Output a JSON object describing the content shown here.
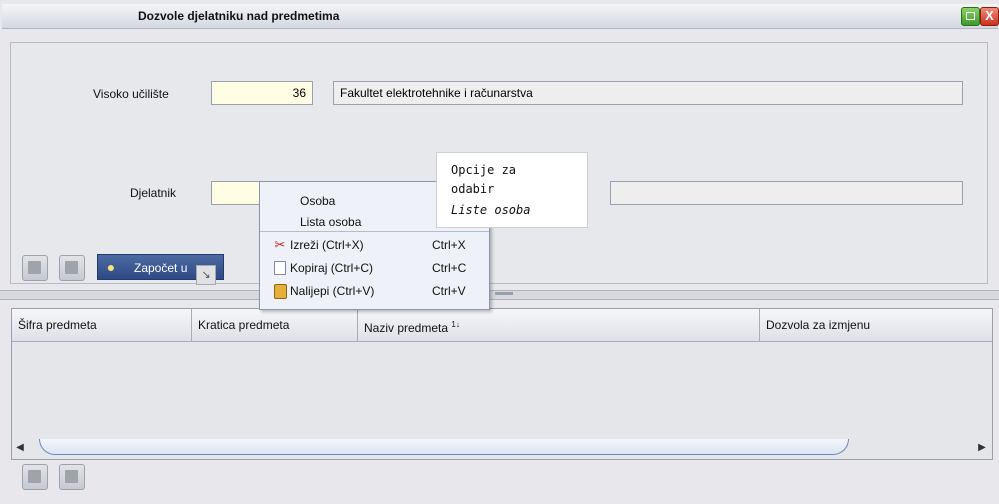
{
  "window": {
    "title": "Dozvole djelatniku nad predmetima",
    "close_label": "X"
  },
  "form": {
    "institution": {
      "label": "Visoko učilište",
      "code": "36",
      "name": "Fakultet elektrotehnike i računarstva"
    },
    "employee": {
      "label": "Djelatnik",
      "code": "",
      "name": ""
    }
  },
  "toolbar": {
    "start_label": "Započet u"
  },
  "context_menu": {
    "items": [
      {
        "label": "Osoba"
      },
      {
        "label": "Lista osoba"
      },
      {
        "label": "Izreži (Ctrl+X)",
        "shortcut": "Ctrl+X",
        "icon": "scissors-icon"
      },
      {
        "label": "Kopiraj (Ctrl+C)",
        "shortcut": "Ctrl+C",
        "icon": "copy-icon"
      },
      {
        "label": "Nalijepi (Ctrl+V)",
        "shortcut": "Ctrl+V",
        "icon": "clipboard-icon"
      }
    ]
  },
  "tooltip": {
    "lines": [
      "Opcije za",
      "odabir",
      "Liste osoba"
    ]
  },
  "table": {
    "columns": [
      "Šifra predmeta",
      "Kratica predmeta",
      "Naziv predmeta",
      "Dozvola za izmjenu"
    ],
    "sort_indicator": "1↓",
    "rows": []
  },
  "colors": {
    "title_bar": "#d4d8e0",
    "start_button": "#2d4a84",
    "input_yellow": "#fffde4",
    "menu_bg": "#eef1f8"
  }
}
